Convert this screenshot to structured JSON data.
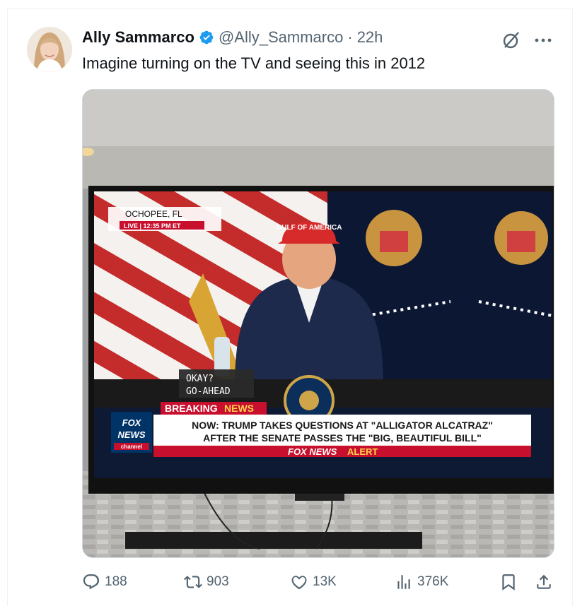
{
  "tweet": {
    "display_name": "Ally Sammarco",
    "handle": "@Ally_Sammarco",
    "separator": "·",
    "timestamp": "22h",
    "text": "Imagine turning on the TV and seeing this in 2012"
  },
  "media": {
    "tv_location": "OCHOPEE, FL",
    "tv_live": "LIVE  |  12:35 PM ET",
    "hat_text": "GULF OF AMERICA",
    "caption_line1": "OKAY?",
    "caption_line2": "GO-AHEAD",
    "breaking_label": "BREAKING",
    "breaking_news": "NEWS",
    "headline_line1": "NOW: TRUMP TAKES QUESTIONS AT \"ALLIGATOR ALCATRAZ\"",
    "headline_line2": "AFTER THE SENATE PASSES THE \"BIG, BEAUTIFUL BILL\"",
    "alert_brand": "FOX NEWS",
    "alert_word": "ALERT",
    "network_logo_line1": "FOX",
    "network_logo_line2": "NEWS",
    "network_logo_line3": "channel"
  },
  "actions": {
    "replies": "188",
    "reposts": "903",
    "likes": "13K",
    "views": "376K"
  },
  "icons": {
    "reply": "reply-icon",
    "repost": "repost-icon",
    "like": "heart-icon",
    "views": "views-icon",
    "bookmark": "bookmark-icon",
    "share": "share-icon",
    "verified": "verified-badge-icon",
    "grok": "grok-icon",
    "more": "more-icon"
  },
  "colors": {
    "verified": "#1d9bf0",
    "secondary_text": "#536471",
    "fox_red": "#c8102e",
    "fox_blue": "#003366"
  }
}
